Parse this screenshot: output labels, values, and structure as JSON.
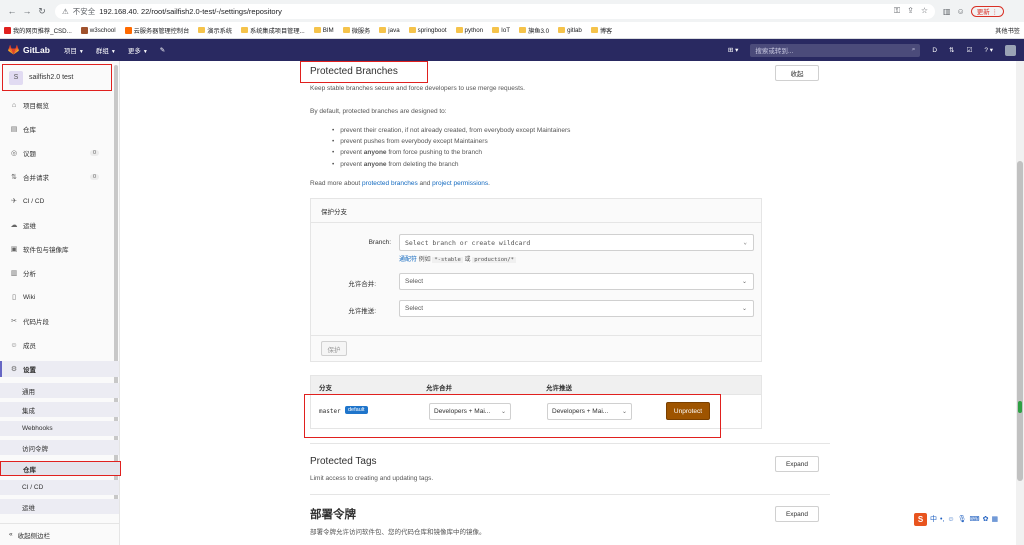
{
  "browser": {
    "security_label": "不安全",
    "url": "192.168.40.    22/root/sailfish2.0-test/-/settings/repository",
    "update_label": "更新 ⋮",
    "bookmarks": [
      {
        "label": "我的网页推荐_CSD...",
        "color": "#e0201e"
      },
      {
        "label": "w3school",
        "color": "#a0522d"
      },
      {
        "label": "云服务器管理控制台",
        "color": "#ff6a00"
      },
      {
        "label": "演示系统",
        "color": "#f5c34b"
      },
      {
        "label": "系统集成项目管理...",
        "color": "#f5c34b"
      },
      {
        "label": "BIM",
        "color": "#f5c34b"
      },
      {
        "label": "微服务",
        "color": "#f5c34b"
      },
      {
        "label": "java",
        "color": "#f5c34b"
      },
      {
        "label": "springboot",
        "color": "#f5c34b"
      },
      {
        "label": "python",
        "color": "#f5c34b"
      },
      {
        "label": "IoT",
        "color": "#f5c34b"
      },
      {
        "label": "旗鱼3.0",
        "color": "#f5c34b"
      },
      {
        "label": "gitlab",
        "color": "#f5c34b"
      },
      {
        "label": "博客",
        "color": "#f5c34b"
      }
    ],
    "other_bookmarks": "其他书签"
  },
  "gitlab_header": {
    "logo_text": "GitLab",
    "menu": [
      "项目",
      "群组",
      "更多"
    ],
    "search_placeholder": "搜索或转到...",
    "avatar_caption": "Administrator"
  },
  "sidebar": {
    "project_initial": "S",
    "project_name": "sailfish2.0 test",
    "items": [
      {
        "label": "项目概览",
        "icon": "home-icon",
        "glyph": "⌂"
      },
      {
        "label": "仓库",
        "icon": "repository-icon",
        "glyph": "▤"
      },
      {
        "label": "议题",
        "icon": "issues-icon",
        "glyph": "◎",
        "count": "0"
      },
      {
        "label": "合并请求",
        "icon": "merge-request-icon",
        "glyph": "⇅",
        "count": "0"
      },
      {
        "label": "CI / CD",
        "icon": "rocket-icon",
        "glyph": "✈"
      },
      {
        "label": "运维",
        "icon": "cloud-icon",
        "glyph": "☁"
      },
      {
        "label": "软件包与镜像库",
        "icon": "package-icon",
        "glyph": "▣"
      },
      {
        "label": "分析",
        "icon": "chart-icon",
        "glyph": "▥"
      },
      {
        "label": "Wiki",
        "icon": "book-icon",
        "glyph": "▯"
      },
      {
        "label": "代码片段",
        "icon": "snippet-icon",
        "glyph": "✂"
      },
      {
        "label": "成员",
        "icon": "users-icon",
        "glyph": "☺"
      },
      {
        "label": "设置",
        "icon": "settings-icon",
        "glyph": "⚙"
      }
    ],
    "sub_items": [
      "通用",
      "集成",
      "Webhooks",
      "访问令牌",
      "仓库",
      "CI / CD",
      "运维"
    ],
    "collapse_label": "收起侧边栏"
  },
  "protected_branches": {
    "title": "Protected Branches",
    "collapse_label": "收起",
    "description": "Keep stable branches secure and force developers to use merge requests.",
    "intro": "By default, protected branches are designed to:",
    "bullets": [
      "prevent their creation, if not already created, from everybody except Maintainers",
      "prevent pushes from everybody except Maintainers",
      "prevent anyone from force pushing to the branch",
      "prevent anyone from deleting the branch"
    ],
    "read_more_prefix": "Read more about ",
    "read_more_link1": "protected branches",
    "read_more_and": " and ",
    "read_more_link2": "project permissions",
    "read_more_suffix": ".",
    "form": {
      "heading": "保护分支",
      "branch_label": "Branch:",
      "branch_placeholder": "Select branch or create wildcard",
      "wildcard_hint_link": "通配符",
      "wildcard_hint_mid": " 例如 ",
      "wildcard_hint_code1": "*-stable",
      "wildcard_hint_or": " 或 ",
      "wildcard_hint_code2": "production/*",
      "merge_label": "允许合并:",
      "merge_value": "Select",
      "push_label": "允许推送:",
      "push_value": "Select",
      "protect_button": "保护"
    },
    "table": {
      "col_branch": "分支",
      "col_merge": "允许合并",
      "col_push": "允许推送",
      "rows": [
        {
          "branch": "master",
          "badge": "default",
          "merge": "Developers + Mai...",
          "push": "Developers + Mai...",
          "action": "Unprotect"
        }
      ]
    }
  },
  "protected_tags": {
    "title": "Protected Tags",
    "description": "Limit access to creating and updating tags.",
    "expand_label": "Expand"
  },
  "deploy_tokens": {
    "title": "部署令牌",
    "description": "部署令牌允许访问软件包、您的代码仓库和镜像库中的镜像。",
    "expand_label": "Expand"
  },
  "ime": {
    "logo": "S",
    "mode": "中"
  },
  "colors": {
    "gitlab_header": "#292961",
    "highlight": "#e0201e",
    "unprotect": "#9e5400",
    "link": "#1068bf",
    "badge": "#1f75cb"
  }
}
